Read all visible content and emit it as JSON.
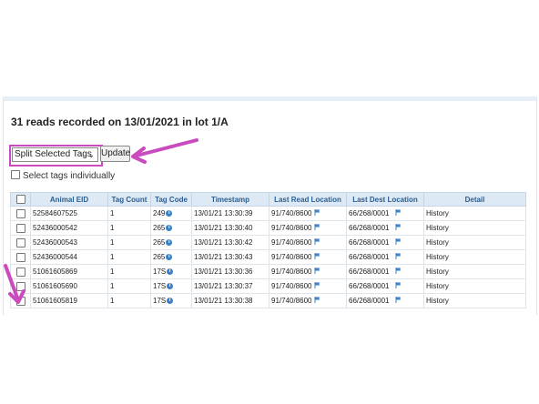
{
  "header": {
    "title": "31 reads recorded on 13/01/2021 in lot 1/A"
  },
  "controls": {
    "action_select_value": "Split Selected Tags",
    "update_label": "Update",
    "select_individually_label": "Select tags individually"
  },
  "table": {
    "columns": [
      "Animal EID",
      "Tag Count",
      "Tag Code",
      "Timestamp",
      "Last Read Location",
      "Last Dest Location",
      "Detail"
    ],
    "rows": [
      {
        "eid": "52584607525",
        "count": "1",
        "code": "249",
        "time": "13/01/21 13:30:39",
        "read_loc": "91/740/8600",
        "dest_loc": "66/268/0001",
        "detail": "History"
      },
      {
        "eid": "52436000542",
        "count": "1",
        "code": "265",
        "time": "13/01/21 13:30:40",
        "read_loc": "91/740/8600",
        "dest_loc": "66/268/0001",
        "detail": "History"
      },
      {
        "eid": "52436000543",
        "count": "1",
        "code": "265",
        "time": "13/01/21 13:30:42",
        "read_loc": "91/740/8600",
        "dest_loc": "66/268/0001",
        "detail": "History"
      },
      {
        "eid": "52436000544",
        "count": "1",
        "code": "265",
        "time": "13/01/21 13:30:43",
        "read_loc": "91/740/8600",
        "dest_loc": "66/268/0001",
        "detail": "History"
      },
      {
        "eid": "51061605869",
        "count": "1",
        "code": "17S",
        "time": "13/01/21 13:30:36",
        "read_loc": "91/740/8600",
        "dest_loc": "66/268/0001",
        "detail": "History"
      },
      {
        "eid": "51061605690",
        "count": "1",
        "code": "17S",
        "time": "13/01/21 13:30:37",
        "read_loc": "91/740/8600",
        "dest_loc": "66/268/0001",
        "detail": "History"
      },
      {
        "eid": "51061605819",
        "count": "1",
        "code": "17S",
        "time": "13/01/21 13:30:38",
        "read_loc": "91/740/8600",
        "dest_loc": "66/268/0001",
        "detail": "History"
      }
    ]
  },
  "icons": {
    "info": "info-icon",
    "flag": "flag-icon",
    "annotation": "arrow"
  },
  "colors": {
    "annotation": "#c94bbd",
    "header_bg": "#dde9f5",
    "header_text": "#2b5d8f",
    "info": "#3b7fc4"
  }
}
